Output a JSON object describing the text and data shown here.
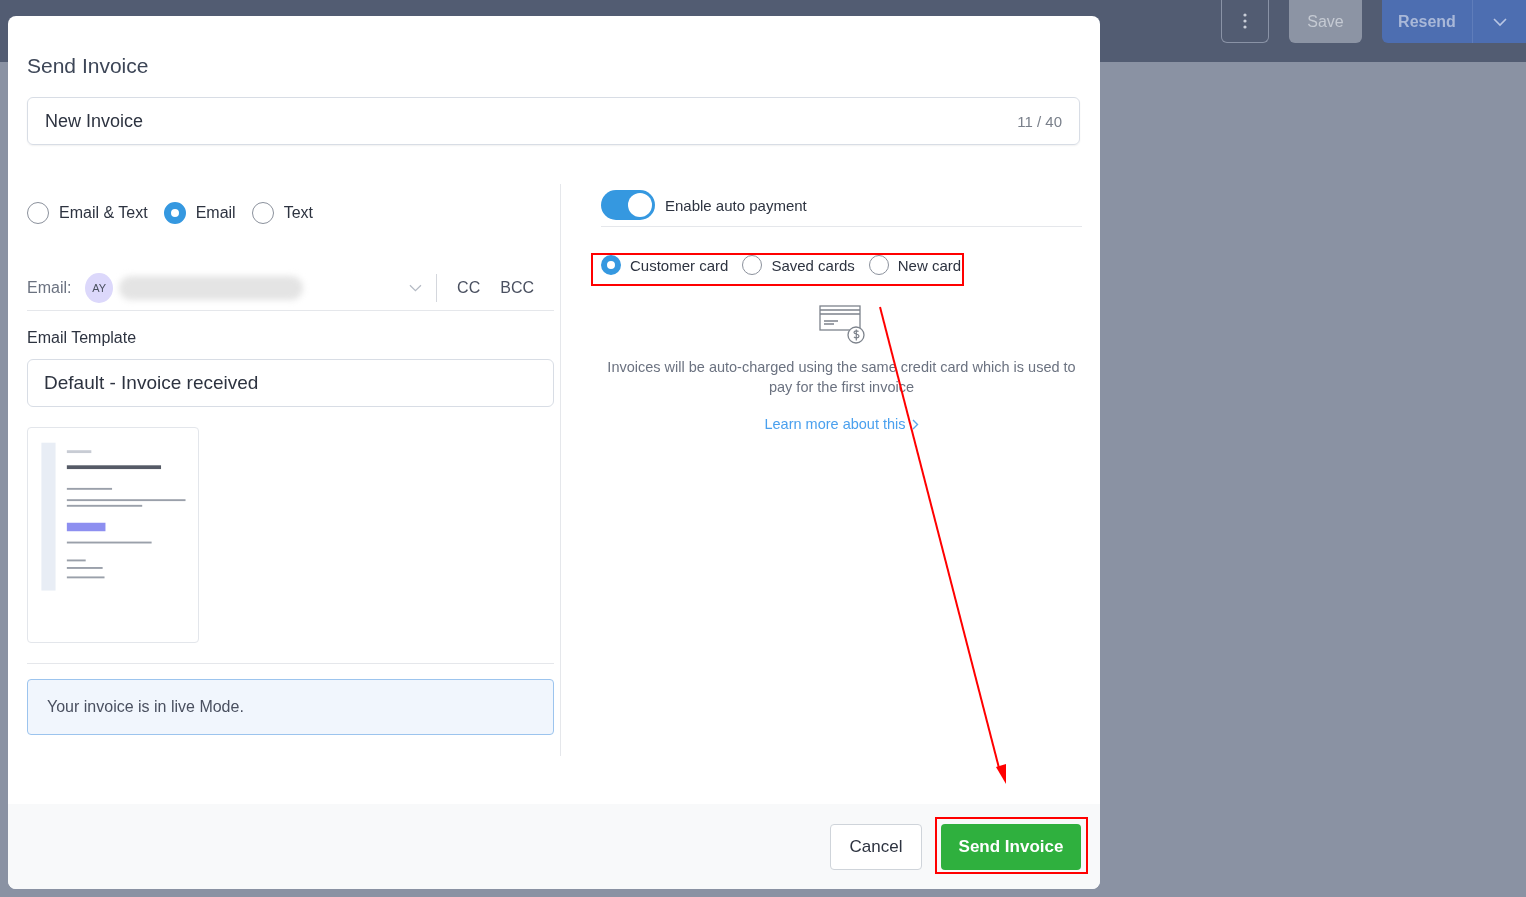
{
  "background": {
    "save": "Save",
    "resend": "Resend"
  },
  "modal": {
    "title": "Send Invoice",
    "name_field": {
      "value": "New Invoice",
      "counter": "11 / 40"
    },
    "channels": [
      {
        "label": "Email & Text",
        "selected": false
      },
      {
        "label": "Email",
        "selected": true
      },
      {
        "label": "Text",
        "selected": false
      }
    ],
    "email": {
      "label": "Email:",
      "avatar": "AY",
      "cc": "CC",
      "bcc": "BCC"
    },
    "template": {
      "label": "Email Template",
      "value": "Default - Invoice received"
    },
    "notice": "Your invoice is in live Mode.",
    "auto_payment": {
      "label": "Enable auto payment",
      "on": true
    },
    "card_options": [
      {
        "label": "Customer card",
        "selected": true
      },
      {
        "label": "Saved cards",
        "selected": false
      },
      {
        "label": "New card",
        "selected": false
      }
    ],
    "description": "Invoices will be auto-charged using the same credit card which is used to pay for the first invoice",
    "learn_more": "Learn more about this",
    "buttons": {
      "cancel": "Cancel",
      "send": "Send Invoice"
    }
  }
}
